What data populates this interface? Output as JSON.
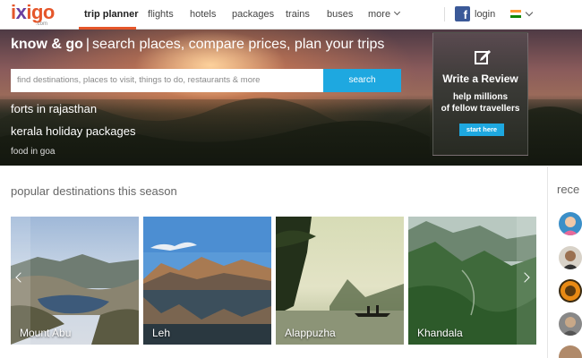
{
  "brand": {
    "name_a": "i",
    "name_x": "x",
    "name_b": "igo",
    "sub": ".com"
  },
  "nav": {
    "items": [
      {
        "label": "trip planner",
        "active": true
      },
      {
        "label": "flights"
      },
      {
        "label": "hotels"
      },
      {
        "label": "packages"
      },
      {
        "label": "trains"
      },
      {
        "label": "buses"
      },
      {
        "label": "more"
      }
    ],
    "fb_letter": "f",
    "login": "login"
  },
  "hero": {
    "title_bold": "know & go",
    "bar": "|",
    "title_rest": "search places, compare prices, plan your trips",
    "search_placeholder": "find destinations, places to visit, things to do, restaurants & more",
    "search_button": "search",
    "quick_links": [
      "forts in rajasthan",
      "kerala holiday packages",
      "food in goa"
    ]
  },
  "review_card": {
    "title": "Write a Review",
    "line1": "help millions",
    "line2": "of fellow travellers",
    "button": "start here"
  },
  "popular": {
    "title": "popular destinations this season",
    "destinations": [
      "Mount Abu",
      "Leh",
      "Alappuzha",
      "Khandala"
    ]
  },
  "sidebar": {
    "title": "rece"
  },
  "colors": {
    "accent": "#e5562a",
    "brand_purple": "#6b3fa0",
    "button_blue": "#1ea8e0",
    "facebook": "#3b5998"
  }
}
